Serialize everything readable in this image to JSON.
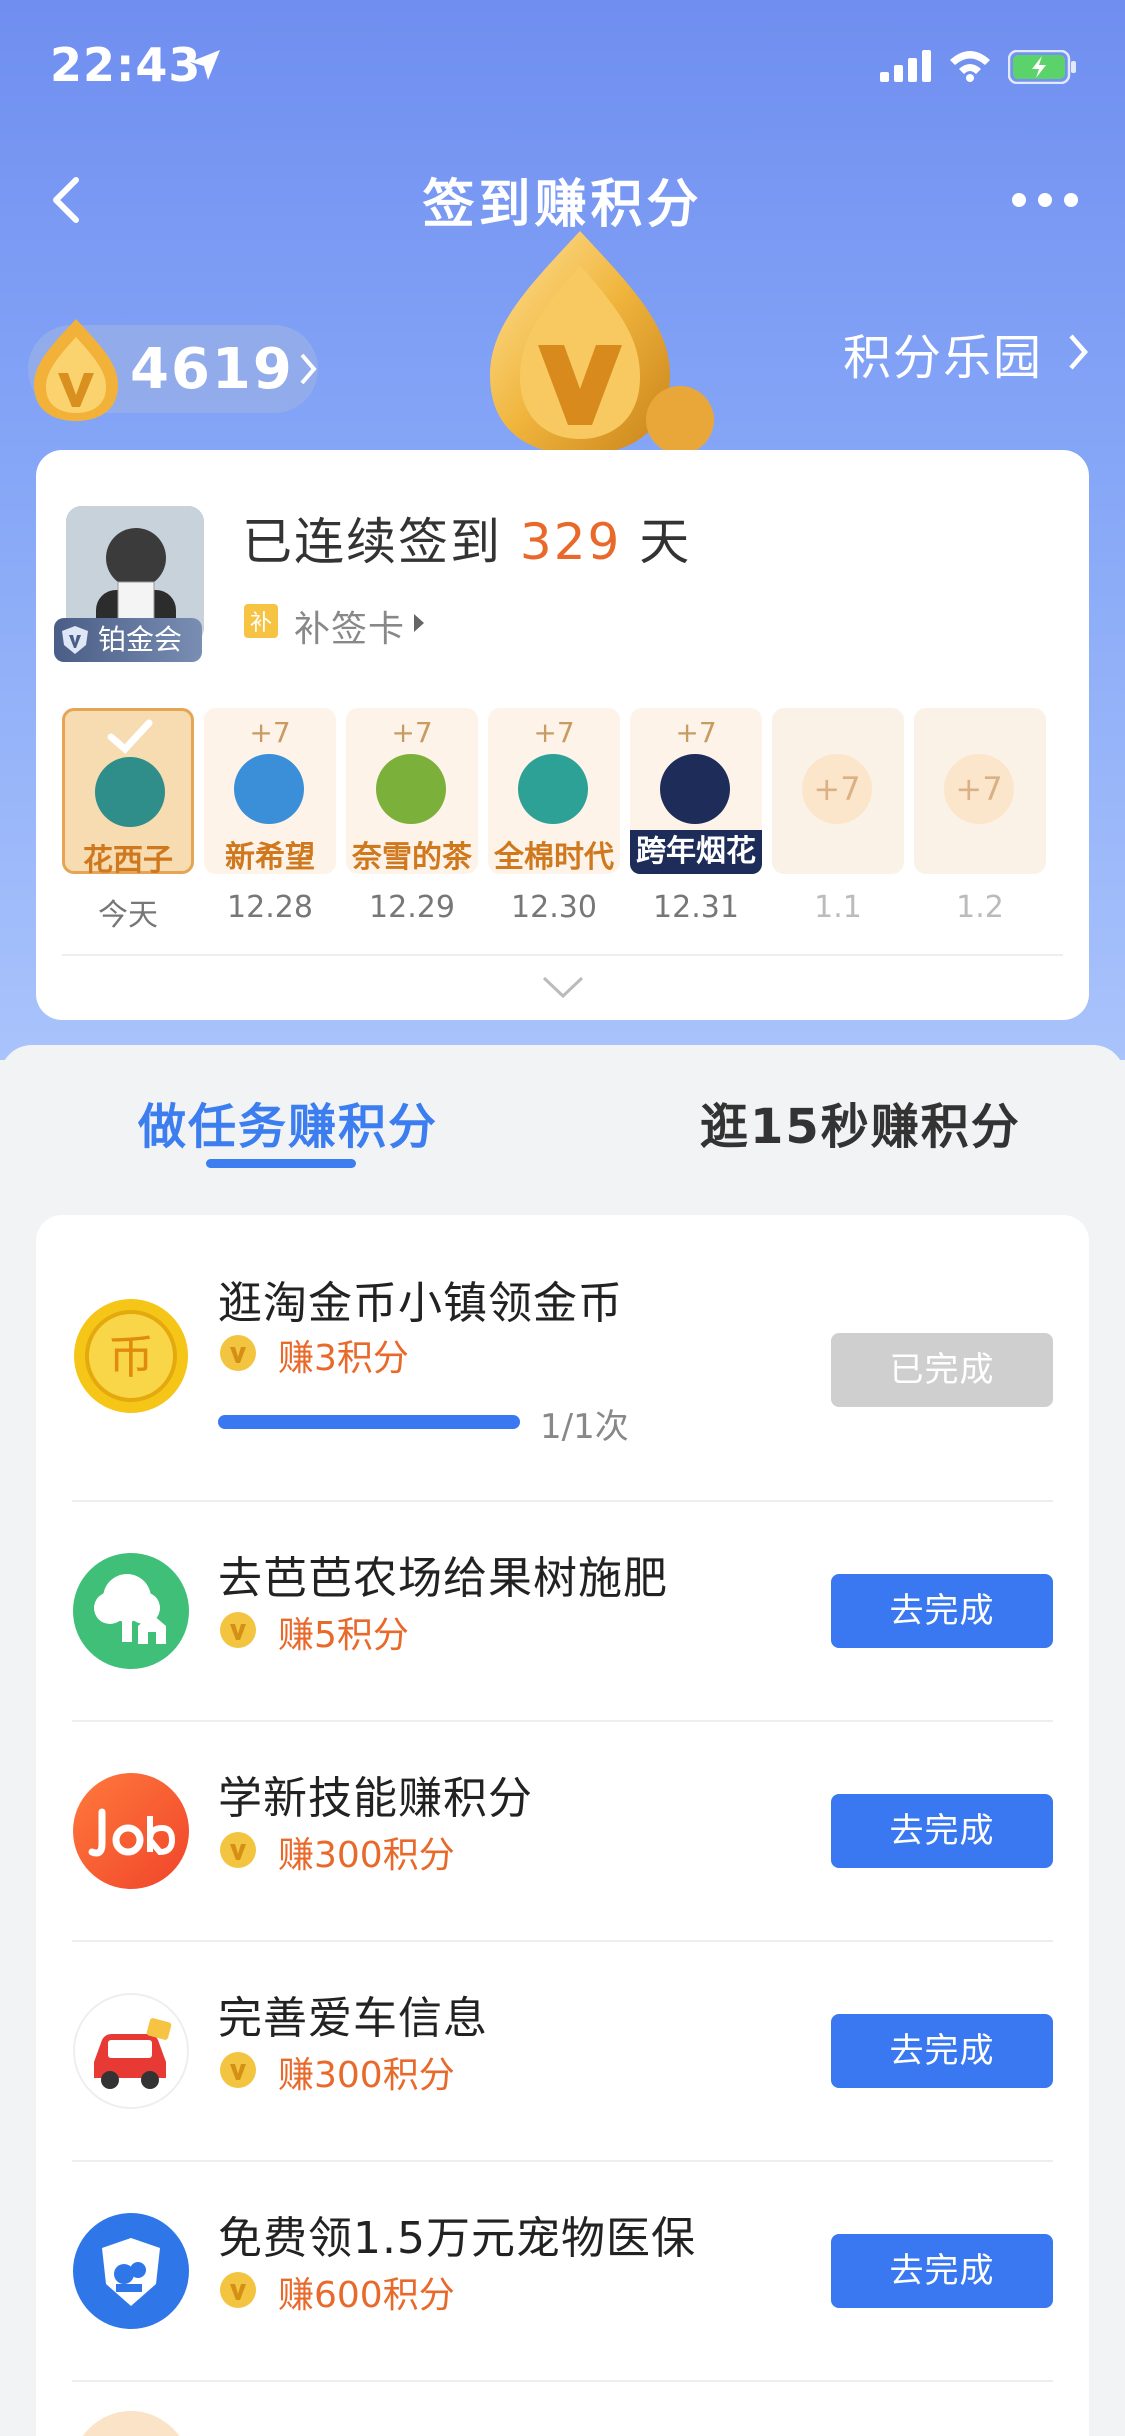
{
  "status_bar": {
    "time": "22:43"
  },
  "nav": {
    "title": "签到赚积分"
  },
  "points": {
    "value": "4619",
    "park_label": "积分乐园"
  },
  "sign_card": {
    "member_badge": "铂金会员",
    "streak_prefix": "已连续签到",
    "streak_days": "329",
    "streak_suffix": "天",
    "makeup_label": "补签卡",
    "days": [
      {
        "plus": "",
        "brand": "花西子",
        "date": "今天",
        "state": "today"
      },
      {
        "plus": "+7",
        "brand": "新希望",
        "date": "12.28",
        "state": "past"
      },
      {
        "plus": "+7",
        "brand": "奈雪的茶",
        "date": "12.29",
        "state": "past"
      },
      {
        "plus": "+7",
        "brand": "全棉时代",
        "date": "12.30",
        "state": "past"
      },
      {
        "plus": "+7",
        "brand": "跨年烟花",
        "date": "12.31",
        "state": "past"
      },
      {
        "plus": "+7",
        "brand": "",
        "date": "1.1",
        "state": "future"
      },
      {
        "plus": "+7",
        "brand": "",
        "date": "1.2",
        "state": "future"
      }
    ]
  },
  "tabs": {
    "active": "做任务赚积分",
    "inactive": "逛15秒赚积分"
  },
  "tasks": [
    {
      "title": "逛淘金币小镇领金币",
      "reward": "赚3积分",
      "button": "已完成",
      "progress_label": "1/1次",
      "progress": 1.0,
      "icon": "gold-coin-icon"
    },
    {
      "title": "去芭芭农场给果树施肥",
      "reward": "赚5积分",
      "button": "去完成",
      "icon": "tree-house-icon"
    },
    {
      "title": "学新技能赚积分",
      "reward": "赚300积分",
      "button": "去完成",
      "icon": "job-logo-icon"
    },
    {
      "title": "完善爱车信息",
      "reward": "赚300积分",
      "button": "去完成",
      "icon": "car-icon"
    },
    {
      "title": "免费领1.5万元宠物医保",
      "reward": "赚600积分",
      "button": "去完成",
      "icon": "pet-shield-icon"
    }
  ],
  "colors": {
    "accent": "#3978f1",
    "reward": "#e8692a",
    "hero_top": "#6f8ef0"
  }
}
